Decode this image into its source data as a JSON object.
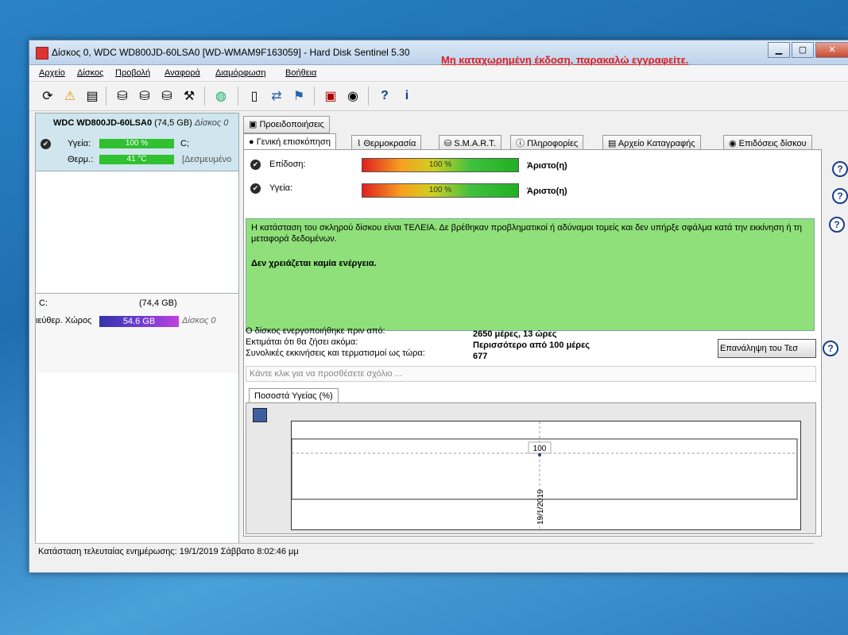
{
  "window": {
    "title": "Δίσκος 0, WDC WD800JD-60LSA0 [WD-WMAM9F163059]  -  Hard Disk Sentinel 5.30",
    "controls": {
      "minimize": "▁",
      "maximize": "▢",
      "close": "✕"
    }
  },
  "menu": [
    "Αρχείο",
    "Δίσκος",
    "Προβολή",
    "Αναφορά",
    "Διαμόρφωση",
    "Βοήθεια"
  ],
  "registration_notice": "Μη καταχωρημένη έκδοση, παρακαλώ εγγραφείτε.",
  "left": {
    "disk_name": "WDC WD800JD-60LSA0",
    "disk_size": "(74,5 GB)",
    "disk_index": "Δίσκος 0",
    "health_label": "Υγεία:",
    "health_value": "100 %",
    "health_drive": "C;",
    "temp_label": "Θερμ.:",
    "temp_value": "41 °C",
    "temp_note": "[Δεσμευμένο",
    "partition_letter": "C:",
    "partition_size": "(74,4 GB)",
    "free_label": "ιεύθερ. Χώρος",
    "free_value": "54.6 GB",
    "free_disk": "Δίσκος 0"
  },
  "tabs": {
    "top": "Προειδοποιήσεις",
    "main": [
      "Γενική επισκόπηση",
      "Θερμοκρασία",
      "S.M.A.R.T.",
      "Πληροφορίες",
      "Αρχείο Καταγραφής",
      "Επιδόσεις δίσκου"
    ]
  },
  "overview": {
    "performance_label": "Επίδοση:",
    "performance_value": "100 %",
    "performance_rating": "Άριστο(η)",
    "health_label": "Υγεία:",
    "health_value": "100 %",
    "health_rating": "Άριστο(η)",
    "status_text": "Η κατάσταση του σκληρού δίσκου είναι ΤΕΛΕΙΑ. Δε βρέθηκαν προβληματικοί ή αδύναμοι τομείς και δεν υπήρξε σφάλμα κατά την εκκίνηση ή τη μεταφορά δεδομένων.",
    "action_text": "Δεν χρειάζεται καμία ενέργεια.",
    "powered_on_label": "Ο δίσκος ενεργοποιήθηκε πριν από:",
    "powered_on_value": "2650 μέρες, 13 ώρες",
    "lifetime_label": "Εκτιμάται ότι θα ζήσει ακόμα:",
    "lifetime_value": "Περισσότερο από 100 μέρες",
    "starts_label": "Συνολικές εκκινήσεις και τερματισμοί ως τώρα:",
    "starts_value": "677",
    "repeat_button": "Επανάληψη του Τεσ",
    "comment_placeholder": "Κάντε κλικ για να προσθέσετε σχόλιο ..."
  },
  "chart_tab": "Ποσοστά Υγείας (%)",
  "chart_data": {
    "type": "line",
    "x": [
      "19/1/2019"
    ],
    "series": [
      {
        "values": [
          100
        ]
      }
    ],
    "ytick": "100",
    "xtick": "19/1/2019",
    "point_label": "100"
  },
  "status_bar": "Κατάσταση τελευταίας ενημέρωσης: 19/1/2019 Σάββατο 8:02:46 μμ"
}
